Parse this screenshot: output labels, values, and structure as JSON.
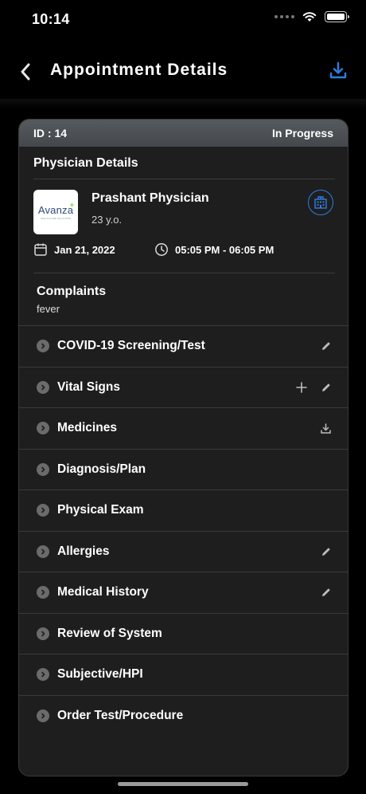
{
  "status_bar": {
    "time": "10:14"
  },
  "header": {
    "title": "Appointment Details"
  },
  "card": {
    "id_label": "ID : 14",
    "status": "In Progress",
    "section_title": "Physician Details",
    "logo_text": "Avanza",
    "logo_subtext": "HEALTHCARE SOLUTIONS",
    "physician_name": "Prashant Physician",
    "physician_age": "23 y.o.",
    "date": "Jan 21, 2022",
    "time": "05:05 PM - 06:05 PM",
    "complaints_title": "Complaints",
    "complaints_value": "fever"
  },
  "sections": [
    {
      "label": "COVID-19 Screening/Test",
      "actions": [
        "edit-icon"
      ]
    },
    {
      "label": "Vital Signs",
      "actions": [
        "plus-icon",
        "edit-icon"
      ]
    },
    {
      "label": "Medicines",
      "actions": [
        "download-icon"
      ]
    },
    {
      "label": "Diagnosis/Plan",
      "actions": []
    },
    {
      "label": "Physical Exam",
      "actions": []
    },
    {
      "label": "Allergies",
      "actions": [
        "edit-icon"
      ]
    },
    {
      "label": "Medical History",
      "actions": [
        "edit-icon"
      ]
    },
    {
      "label": "Review of System",
      "actions": []
    },
    {
      "label": "Subjective/HPI",
      "actions": []
    },
    {
      "label": "Order Test/Procedure",
      "actions": []
    }
  ],
  "colors": {
    "accent": "#2f7de1",
    "background": "#000000",
    "card": "#1e1e1e"
  }
}
